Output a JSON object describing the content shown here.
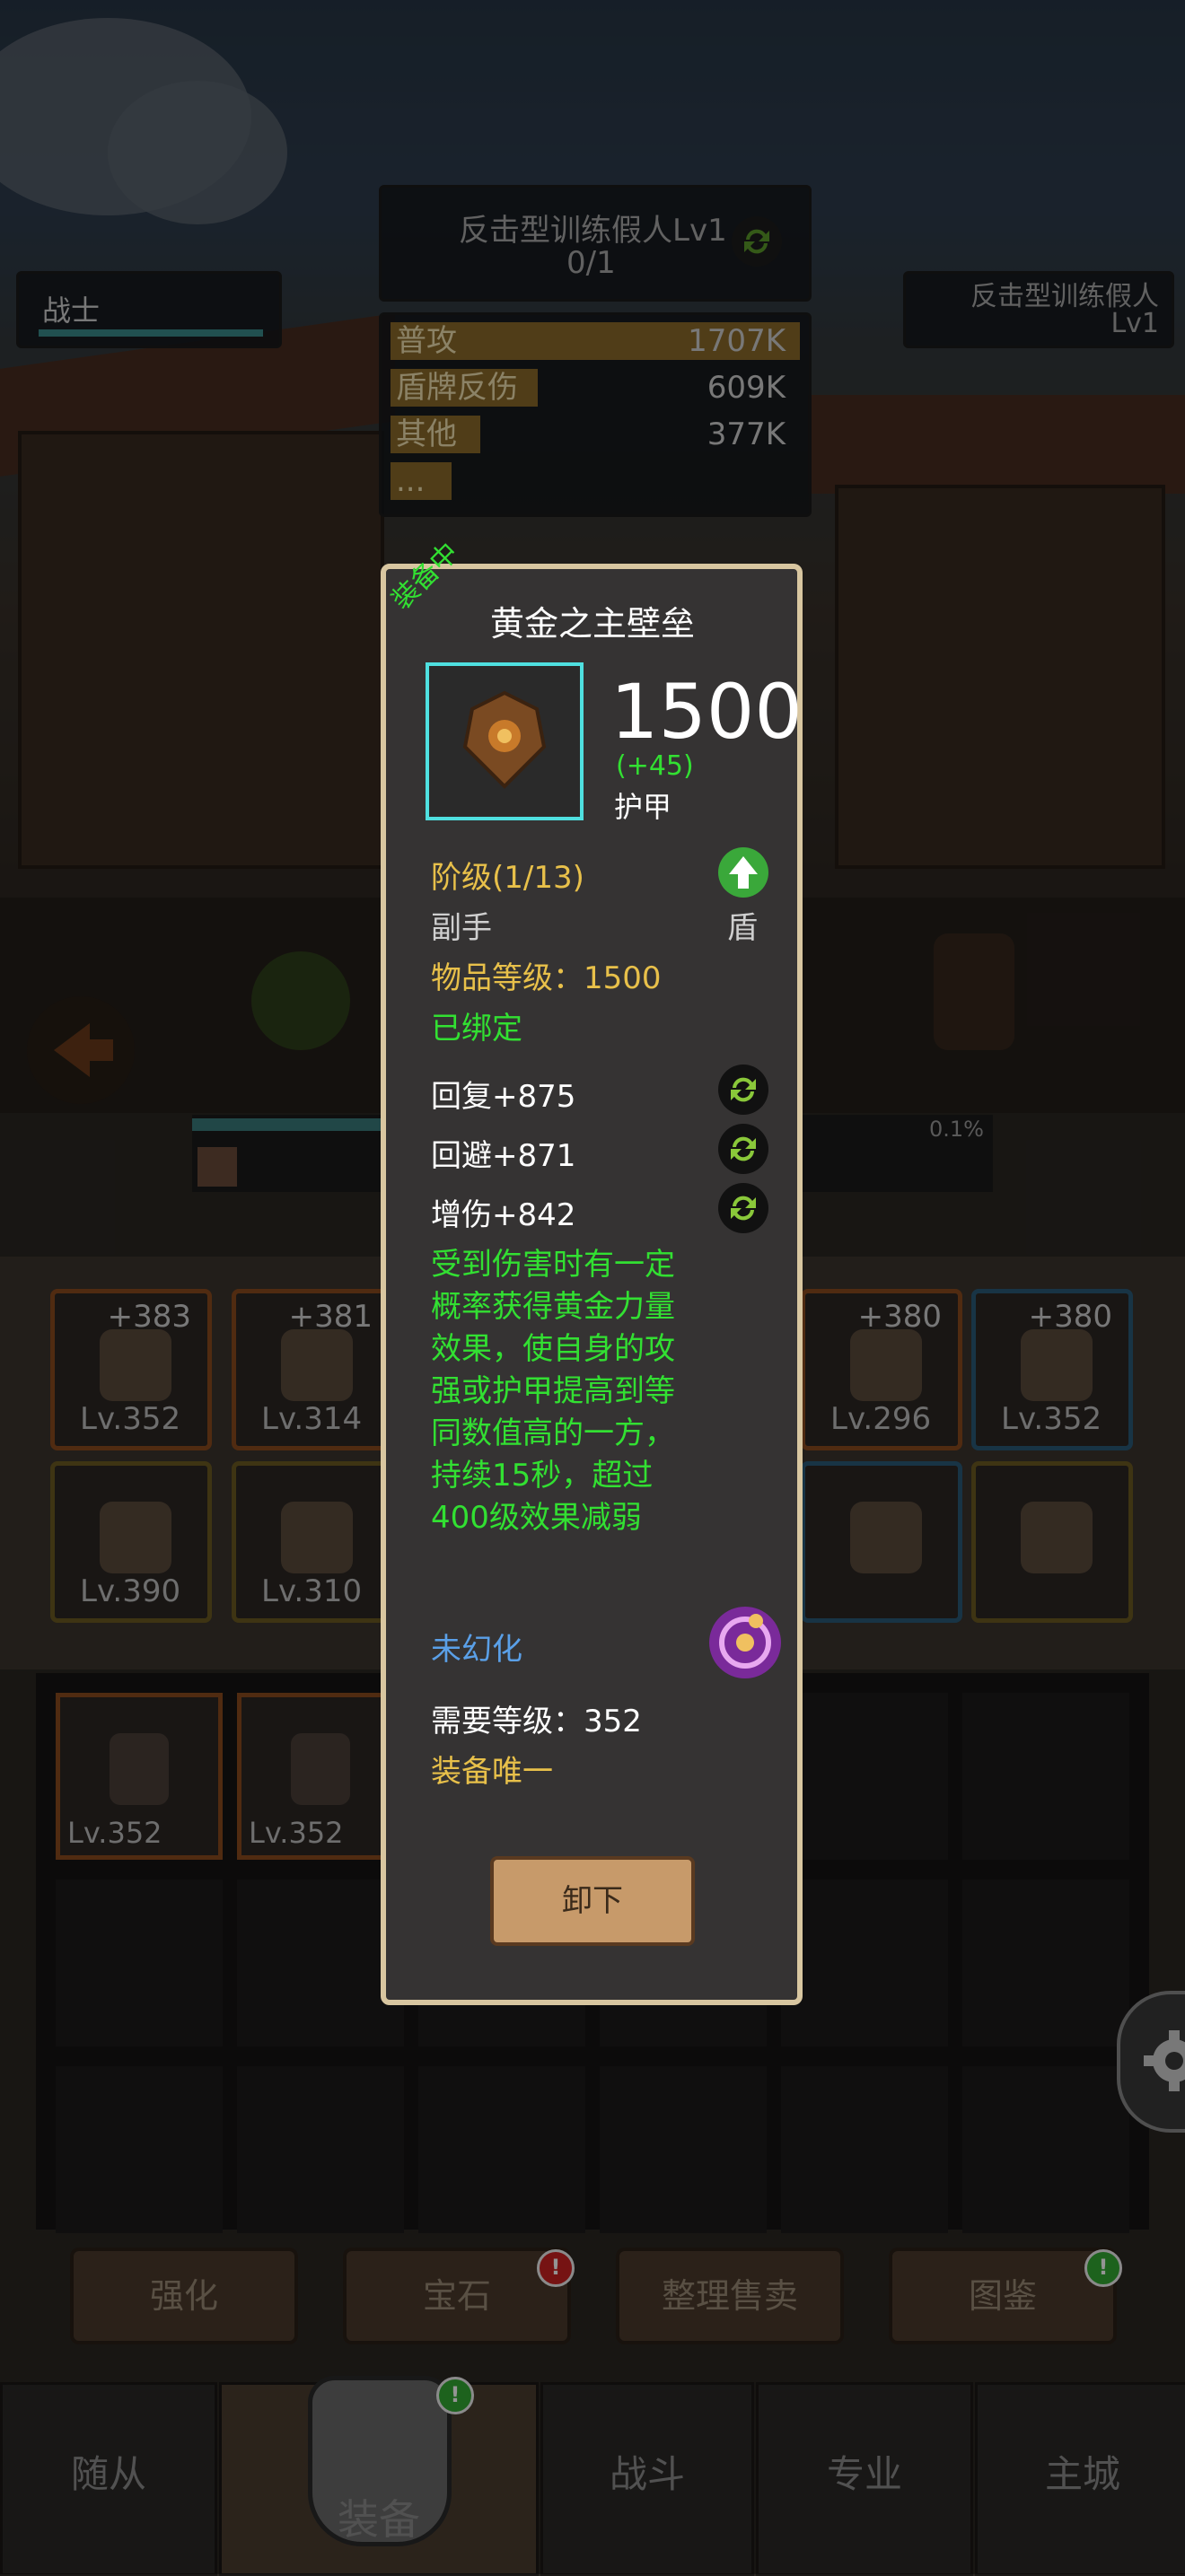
{
  "hud": {
    "player_label": "战士",
    "target_name": "反击型训练假人Lv1",
    "target_count": "0/1",
    "enemy_name": "反击型训练假人",
    "enemy_level": "Lv1",
    "damage_stats": [
      {
        "name": "普攻",
        "value": "1707K",
        "fill": 1.0
      },
      {
        "name": "盾牌反伤",
        "value": "609K",
        "fill": 0.36
      },
      {
        "name": "其他",
        "value": "377K",
        "fill": 0.22
      },
      {
        "name": "...",
        "value": "",
        "fill": 0.15
      }
    ],
    "progress_percent": "0.1%"
  },
  "equip_slots": [
    {
      "plus": "+383",
      "level": "Lv.352",
      "color": "orange"
    },
    {
      "plus": "+381",
      "level": "Lv.314",
      "color": "orange"
    },
    {
      "plus": "+380",
      "level": "Lv.296",
      "color": "orange"
    },
    {
      "plus": "+380",
      "level": "Lv.352",
      "color": "blue"
    },
    {
      "plus": "",
      "level": "Lv.390",
      "color": "gold"
    },
    {
      "plus": "",
      "level": "Lv.310",
      "color": "gold"
    },
    {
      "plus": "",
      "level": "",
      "color": "blue"
    },
    {
      "plus": "",
      "level": "",
      "color": "gold"
    }
  ],
  "inventory": [
    {
      "level": "Lv.352"
    },
    {
      "level": "Lv.352"
    }
  ],
  "actions": {
    "strengthen": "强化",
    "gem": "宝石",
    "sort_sell": "整理售卖",
    "codex": "图鉴",
    "badge": "!"
  },
  "tabs": {
    "followers": "随从",
    "equipment": "装备",
    "battle": "战斗",
    "profession": "专业",
    "main_city": "主城"
  },
  "item": {
    "equipped_tag": "装备中",
    "name": "黄金之主壁垒",
    "armor_value": "1500",
    "armor_bonus": "(+45)",
    "armor_label": "护甲",
    "tier": "阶级(1/13)",
    "slot_type": "副手",
    "sub_type": "盾",
    "item_level": "物品等级：1500",
    "bound": "已绑定",
    "stats": [
      "回复+875",
      "回避+871",
      "增伤+842"
    ],
    "effect_lines": [
      "受到伤害时有一定",
      "概率获得黄金力量",
      "效果，使自身的攻",
      "强或护甲提高到等",
      "同数值高的一方，",
      "持续15秒，超过",
      "400级效果减弱"
    ],
    "illusion": "未幻化",
    "required_level": "需要等级：352",
    "unique": "装备唯一",
    "unequip_button": "卸下"
  },
  "colors": {
    "gold_text": "#e8c04a",
    "green_text": "#32e032",
    "blue_text": "#5aa0e8",
    "frame_cyan": "#4fe0e0",
    "popup_border": "#d8c6a0"
  }
}
